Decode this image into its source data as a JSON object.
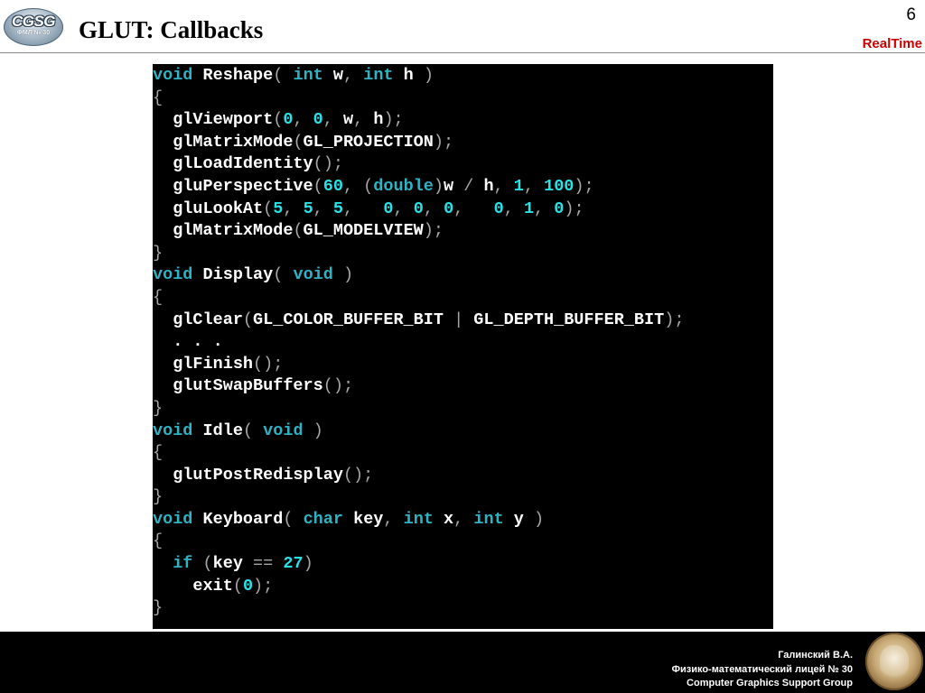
{
  "header": {
    "logo_text": "CGSG",
    "logo_subtext": "ФМЛ № 30",
    "title": "GLUT: Callbacks",
    "page_number": "6",
    "brand": "RealTime"
  },
  "footer": {
    "author": "Галинский В.А.",
    "school": "Физико-математический лицей № 30",
    "group": "Computer Graphics Support Group"
  },
  "colors": {
    "background": "#ffffff",
    "code_background": "#000000",
    "keyword": "#2eb3c4",
    "number": "#27e3e8",
    "punctuation": "#a7a7a7",
    "identifier": "#ffffff",
    "brand": "#cc0000",
    "footer_background": "#000000"
  },
  "code": [
    [
      [
        "kw",
        "void"
      ],
      [
        "id",
        " Reshape"
      ],
      [
        "p",
        "( "
      ],
      [
        "kw",
        "int"
      ],
      [
        "id",
        " w"
      ],
      [
        "p",
        ", "
      ],
      [
        "kw",
        "int"
      ],
      [
        "id",
        " h"
      ],
      [
        "p",
        " )"
      ]
    ],
    [
      [
        "p",
        "{"
      ]
    ],
    [
      [
        "id",
        "  glViewport"
      ],
      [
        "p",
        "("
      ],
      [
        "num",
        "0"
      ],
      [
        "p",
        ", "
      ],
      [
        "num",
        "0"
      ],
      [
        "p",
        ", "
      ],
      [
        "id",
        "w"
      ],
      [
        "p",
        ", "
      ],
      [
        "id",
        "h"
      ],
      [
        "p",
        ");"
      ]
    ],
    [
      [
        "id",
        "  glMatrixMode"
      ],
      [
        "p",
        "("
      ],
      [
        "id",
        "GL_PROJECTION"
      ],
      [
        "p",
        ");"
      ]
    ],
    [
      [
        "id",
        "  glLoadIdentity"
      ],
      [
        "p",
        "();"
      ]
    ],
    [
      [
        "id",
        "  gluPerspective"
      ],
      [
        "p",
        "("
      ],
      [
        "num",
        "60"
      ],
      [
        "p",
        ", ("
      ],
      [
        "kw",
        "double"
      ],
      [
        "p",
        ")"
      ],
      [
        "id",
        "w"
      ],
      [
        "p",
        " / "
      ],
      [
        "id",
        "h"
      ],
      [
        "p",
        ", "
      ],
      [
        "num",
        "1"
      ],
      [
        "p",
        ", "
      ],
      [
        "num",
        "100"
      ],
      [
        "p",
        ");"
      ]
    ],
    [
      [
        "id",
        "  gluLookAt"
      ],
      [
        "p",
        "("
      ],
      [
        "num",
        "5"
      ],
      [
        "p",
        ", "
      ],
      [
        "num",
        "5"
      ],
      [
        "p",
        ", "
      ],
      [
        "num",
        "5"
      ],
      [
        "p",
        ",   "
      ],
      [
        "num",
        "0"
      ],
      [
        "p",
        ", "
      ],
      [
        "num",
        "0"
      ],
      [
        "p",
        ", "
      ],
      [
        "num",
        "0"
      ],
      [
        "p",
        ",   "
      ],
      [
        "num",
        "0"
      ],
      [
        "p",
        ", "
      ],
      [
        "num",
        "1"
      ],
      [
        "p",
        ", "
      ],
      [
        "num",
        "0"
      ],
      [
        "p",
        ");"
      ]
    ],
    [
      [
        "id",
        "  glMatrixMode"
      ],
      [
        "p",
        "("
      ],
      [
        "id",
        "GL_MODELVIEW"
      ],
      [
        "p",
        ");"
      ]
    ],
    [
      [
        "p",
        "}"
      ]
    ],
    [
      [
        "kw",
        "void"
      ],
      [
        "id",
        " Display"
      ],
      [
        "p",
        "( "
      ],
      [
        "kw",
        "void"
      ],
      [
        "p",
        " )"
      ]
    ],
    [
      [
        "p",
        "{"
      ]
    ],
    [
      [
        "id",
        "  glClear"
      ],
      [
        "p",
        "("
      ],
      [
        "id",
        "GL_COLOR_BUFFER_BIT"
      ],
      [
        "p",
        " | "
      ],
      [
        "id",
        "GL_DEPTH_BUFFER_BIT"
      ],
      [
        "p",
        ");"
      ]
    ],
    [
      [
        "id",
        "  . . ."
      ]
    ],
    [
      [
        "id",
        "  glFinish"
      ],
      [
        "p",
        "();"
      ]
    ],
    [
      [
        "id",
        "  glutSwapBuffers"
      ],
      [
        "p",
        "();"
      ]
    ],
    [
      [
        "p",
        "}"
      ]
    ],
    [
      [
        "kw",
        "void"
      ],
      [
        "id",
        " Idle"
      ],
      [
        "p",
        "( "
      ],
      [
        "kw",
        "void"
      ],
      [
        "p",
        " )"
      ]
    ],
    [
      [
        "p",
        "{"
      ]
    ],
    [
      [
        "id",
        "  glutPostRedisplay"
      ],
      [
        "p",
        "();"
      ]
    ],
    [
      [
        "p",
        "}"
      ]
    ],
    [
      [
        "kw",
        "void"
      ],
      [
        "id",
        " Keyboard"
      ],
      [
        "p",
        "( "
      ],
      [
        "kw",
        "char"
      ],
      [
        "id",
        " key"
      ],
      [
        "p",
        ", "
      ],
      [
        "kw",
        "int"
      ],
      [
        "id",
        " x"
      ],
      [
        "p",
        ", "
      ],
      [
        "kw",
        "int"
      ],
      [
        "id",
        " y"
      ],
      [
        "p",
        " )"
      ]
    ],
    [
      [
        "p",
        "{"
      ]
    ],
    [
      [
        "kw",
        "  if"
      ],
      [
        "p",
        " ("
      ],
      [
        "id",
        "key"
      ],
      [
        "p",
        " == "
      ],
      [
        "num",
        "27"
      ],
      [
        "p",
        ")"
      ]
    ],
    [
      [
        "id",
        "    exit"
      ],
      [
        "p",
        "("
      ],
      [
        "num",
        "0"
      ],
      [
        "p",
        ");"
      ]
    ],
    [
      [
        "p",
        "}"
      ]
    ]
  ]
}
